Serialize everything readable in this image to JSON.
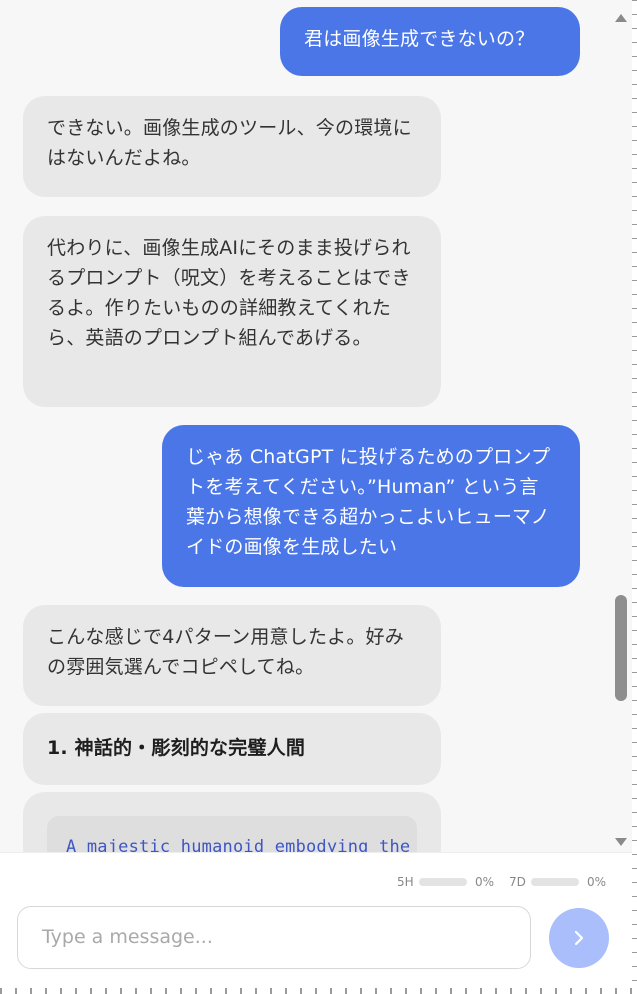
{
  "messages": [
    {
      "role": "user",
      "text": "君は画像生成できないの？"
    },
    {
      "role": "assistant",
      "text": "できない。画像生成のツール、今の環境にはないんだよね。"
    },
    {
      "role": "assistant",
      "text": "代わりに、画像生成AIにそのまま投げられるプロンプト（呪文）を考えることはできるよ。作りたいものの詳細教えてくれたら、英語のプロンプト組んであげる。"
    },
    {
      "role": "user",
      "text": "じゃあ ChatGPT に投げるためのプロンプトを考えてください。”Human” という言葉から想像できる超かっこよいヒューマノイドの画像を生成したい"
    },
    {
      "role": "assistant",
      "text": "こんな感じで4パターン用意したよ。好みの雰囲気選んでコピペしてね。"
    },
    {
      "role": "assistant",
      "text": "1. 神話的・彫刻的な完璧人間"
    },
    {
      "role": "assistant",
      "code": "A majestic humanoid embodying the"
    }
  ],
  "usage": {
    "five_hour": {
      "label": "5H",
      "value": "0%",
      "fraction": 0
    },
    "seven_day": {
      "label": "7D",
      "value": "0%",
      "fraction": 0
    }
  },
  "composer": {
    "placeholder": "Type a message...",
    "send_icon": "chevron-right-icon"
  },
  "colors": {
    "user_bubble": "#4a76e8",
    "assistant_bubble": "#e8e8e8",
    "send_button": "#a9befa"
  }
}
